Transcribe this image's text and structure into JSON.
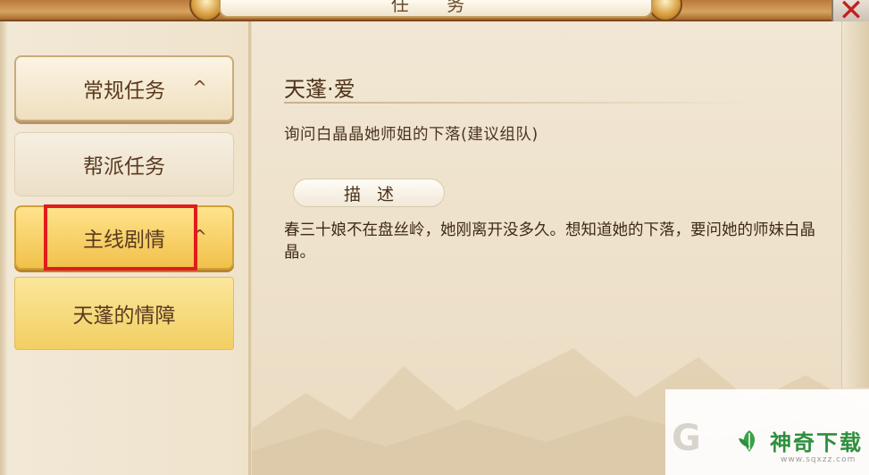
{
  "window": {
    "title": "任 务",
    "close_label": "✕"
  },
  "sidebar": {
    "items": [
      {
        "label": "常规任务",
        "chevron": "^"
      },
      {
        "label": "帮派任务"
      },
      {
        "label": "主线剧情",
        "chevron": "^"
      },
      {
        "label": "天蓬的情障"
      }
    ]
  },
  "quest": {
    "title": "天蓬·爱",
    "objective": "询问白晶晶她师姐的下落(建议组队)",
    "description_button": "描述",
    "description": "春三十娘不在盘丝岭，她刚离开没多久。想知道她的下落，要问她的师妹白晶晶。"
  },
  "watermark": {
    "brand": "神奇下载",
    "url": "www.sqxzz.com",
    "g_glyph": "G"
  },
  "colors": {
    "highlight": "#e21c1c",
    "selected_tab": "#f1c14b",
    "parchment": "#ebdcc2"
  }
}
